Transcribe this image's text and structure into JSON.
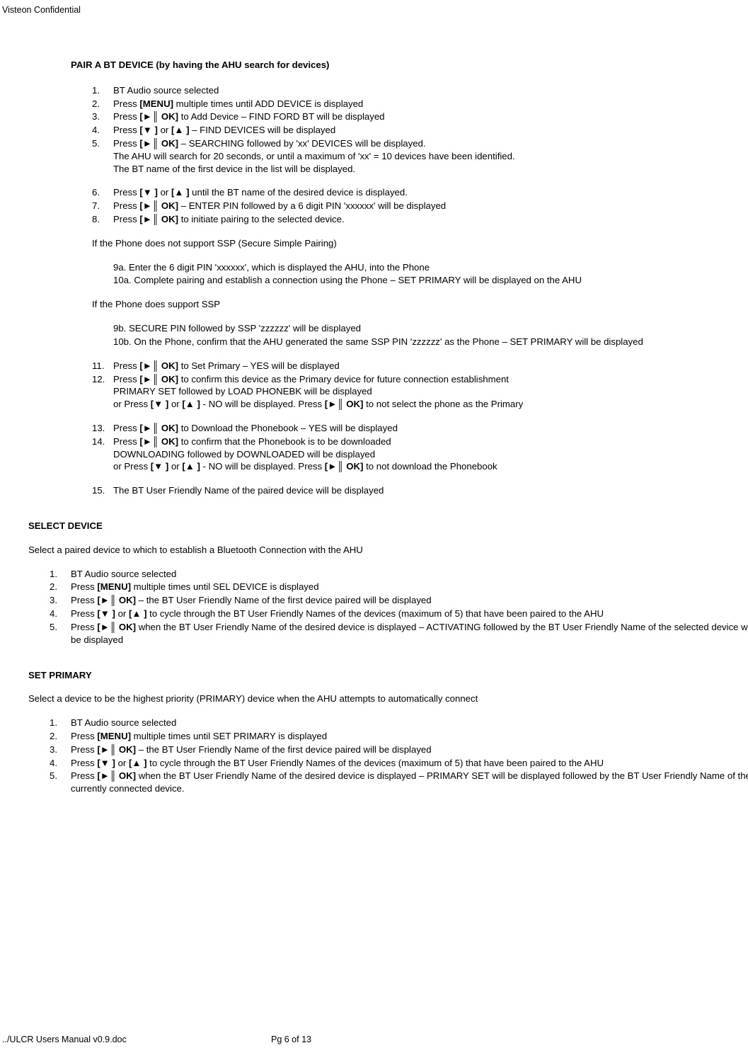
{
  "header": {
    "confidential": "Visteon Confidential"
  },
  "footer": {
    "left": "../ULCR Users Manual v0.9.doc",
    "mid": "Pg 6 of 13"
  },
  "glyph": {
    "play": "►",
    "pause": "║",
    "down": "▼",
    "up": "▲"
  },
  "s1": {
    "title": "PAIR A BT DEVICE (by having the AHU search for devices)",
    "i1": {
      "n": "1.",
      "t": "BT Audio source selected"
    },
    "i2": {
      "n": "2.",
      "a": "Press ",
      "b": "[MENU]",
      "c": " multiple times until ADD DEVICE is displayed"
    },
    "i3": {
      "n": "3.",
      "a": "Press ",
      "b_pre": "[",
      "b_post": " OK]",
      "c": " to Add Device – FIND FORD BT will be displayed"
    },
    "i4": {
      "n": "4.",
      "a": "Press ",
      "b1_pre": "[",
      "b1_post": " ]",
      "mid": " or ",
      "b2_pre": "[",
      "b2_post": " ]",
      "c": " – FIND DEVICES will be displayed"
    },
    "i5": {
      "n": "5.",
      "a": "Press ",
      "b_pre": "[",
      "b_post": " OK]",
      "c": " – SEARCHING followed by 'xx' DEVICES will be displayed.",
      "sub1": "The AHU will search for 20 seconds, or until a maximum of 'xx' = 10 devices have been identified.",
      "sub2": "The BT name of the first device in the list will be displayed."
    },
    "i6": {
      "n": "6.",
      "a": "Press ",
      "b1_pre": "[",
      "b1_post": " ]",
      "mid": " or ",
      "b2_pre": "[",
      "b2_post": " ]",
      "c": " until the BT name of the desired device is displayed."
    },
    "i7": {
      "n": "7.",
      "a": "Press ",
      "b_pre": "[",
      "b_post": " OK]",
      "c": " – ENTER PIN followed by a 6 digit PIN 'xxxxxx' will be displayed"
    },
    "i8": {
      "n": "8.",
      "a": "Press ",
      "b_pre": "[",
      "b_post": " OK]",
      "c": " to initiate pairing to the selected device."
    },
    "no_ssp": {
      "lead": "If the Phone does not support SSP (Secure Simple Pairing)",
      "a": "9a.    Enter the 6 digit PIN 'xxxxxx', which is displayed the AHU, into the Phone",
      "b": "10a.  Complete pairing and establish a connection using the Phone – SET PRIMARY will be displayed on the AHU"
    },
    "ssp": {
      "lead": "If the Phone does support SSP",
      "a": "9b.    SECURE PIN followed by SSP 'zzzzzz' will be displayed",
      "b": "10b.  On the Phone, confirm that the AHU generated the same SSP PIN 'zzzzzz' as the Phone – SET PRIMARY will be displayed"
    },
    "i11": {
      "n": "11.",
      "a": "Press ",
      "b_pre": "[",
      "b_post": " OK]",
      "c": " to Set Primary – YES will be displayed"
    },
    "i12": {
      "n": "12.",
      "a": "Press ",
      "b_pre": "[",
      "b_post": " OK]",
      "c": " to confirm this device as the Primary device for future connection establishment",
      "sub1": "PRIMARY SET followed by LOAD PHONEBK will be displayed",
      "sub2a": "or Press ",
      "sub2_b1_pre": "[",
      "sub2_b1_post": " ]",
      "sub2_mid": " or ",
      "sub2_b2_pre": "[",
      "sub2_b2_post": " ]",
      "sub2c": " - NO will be displayed.  Press ",
      "sub2_ok_pre": "[",
      "sub2_ok_post": " OK]",
      "sub2d": " to not select the phone as the Primary"
    },
    "i13": {
      "n": "13.",
      "a": "Press ",
      "b_pre": "[",
      "b_post": " OK]",
      "c": " to Download the Phonebook – YES will be displayed"
    },
    "i14": {
      "n": "14.",
      "a": "Press ",
      "b_pre": "[",
      "b_post": " OK]",
      "c": " to confirm that the Phonebook is to be downloaded",
      "sub1": "DOWNLOADING followed by DOWNLOADED will be displayed",
      "sub2a": "or Press ",
      "sub2_b1_pre": "[",
      "sub2_b1_post": " ]",
      "sub2_mid": " or ",
      "sub2_b2_pre": "[",
      "sub2_b2_post": " ]",
      "sub2c": " - NO will be displayed.  Press ",
      "sub2_ok_pre": "[",
      "sub2_ok_post": " OK]",
      "sub2d": " to not download the Phonebook"
    },
    "i15": {
      "n": "15.",
      "t": "The BT User Friendly Name of the paired device will be displayed"
    }
  },
  "s2": {
    "title": "SELECT DEVICE",
    "lead": "Select a paired device to which to establish a Bluetooth Connection with the AHU",
    "i1": {
      "n": "1.",
      "t": "BT Audio source selected"
    },
    "i2": {
      "n": "2.",
      "a": "Press ",
      "b": "[MENU]",
      "c": " multiple times until SEL DEVICE is displayed"
    },
    "i3": {
      "n": "3.",
      "a": "Press ",
      "b_pre": "[",
      "b_post": " OK]",
      "c": " – the BT User Friendly Name of the first device paired will be displayed"
    },
    "i4": {
      "n": "4.",
      "a": "Press ",
      "b1_pre": "[",
      "b1_post": " ]",
      "mid": " or ",
      "b2_pre": "[",
      "b2_post": " ]",
      "c": " to cycle through the BT User Friendly Names of the devices (maximum of 5) that have been paired to the AHU"
    },
    "i5": {
      "n": "5.",
      "a": "Press ",
      "b_pre": "[",
      "b_post": " OK]",
      "c": " when the BT User Friendly Name of the desired device is displayed – ACTIVATING followed by the BT User Friendly Name of the selected device will be displayed"
    }
  },
  "s3": {
    "title": "SET PRIMARY",
    "lead": "Select a device to be the highest priority (PRIMARY) device when the AHU attempts to automatically connect",
    "i1": {
      "n": "1.",
      "t": "BT Audio source selected"
    },
    "i2": {
      "n": "2.",
      "a": "Press ",
      "b": "[MENU]",
      "c": " multiple times until SET PRIMARY is displayed"
    },
    "i3": {
      "n": "3.",
      "a": "Press ",
      "b_pre": "[",
      "b_post": " OK]",
      "c": " – the BT User Friendly Name of the first device paired will be displayed"
    },
    "i4": {
      "n": "4.",
      "a": "Press ",
      "b1_pre": "[",
      "b1_post": " ]",
      "mid": " or ",
      "b2_pre": "[",
      "b2_post": " ]",
      "c": " to cycle through the BT User Friendly Names of the devices (maximum of 5) that have been paired to the AHU"
    },
    "i5": {
      "n": "5.",
      "a": "Press ",
      "b_pre": "[",
      "b_post": " OK]",
      "c": " when the BT User Friendly Name of the desired device is displayed – PRIMARY SET will be displayed followed by the BT User Friendly Name of the currently connected device."
    }
  }
}
